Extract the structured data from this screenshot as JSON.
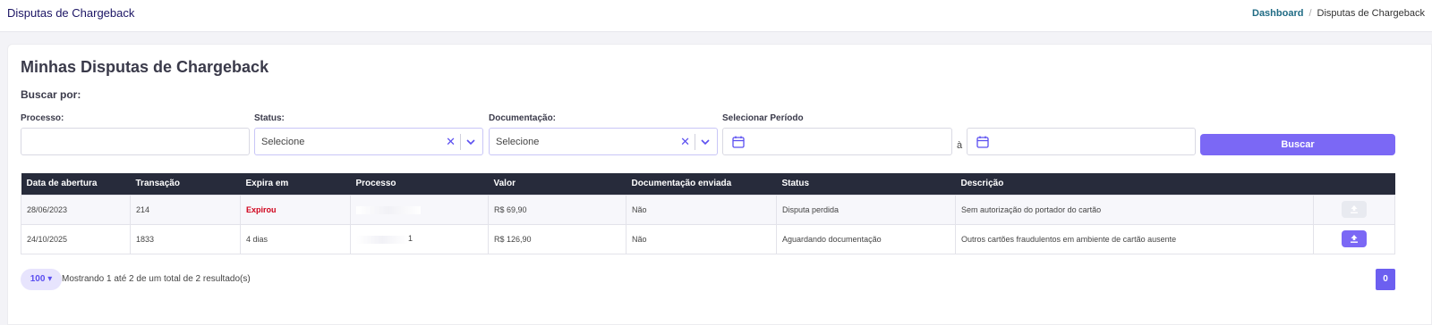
{
  "header": {
    "title": "Disputas de Chargeback",
    "breadcrumb": {
      "link": "Dashboard",
      "separator": "/",
      "current": "Disputas de Chargeback"
    }
  },
  "card": {
    "title": "Minhas Disputas de Chargeback",
    "search_by": "Buscar por:"
  },
  "filters": {
    "processo_label": "Processo:",
    "processo_value": "",
    "status_label": "Status:",
    "status_value": "Selecione",
    "documentacao_label": "Documentação:",
    "documentacao_value": "Selecione",
    "periodo_label": "Selecionar Período",
    "periodo_separator": "à",
    "search_button": "Buscar"
  },
  "table": {
    "headers": [
      "Data de abertura",
      "Transação",
      "Expira em",
      "Processo",
      "Valor",
      "Documentação enviada",
      "Status",
      "Descrição"
    ],
    "rows": [
      {
        "data": "28/06/2023",
        "transacao": "214",
        "expira": "Expirou",
        "processo": "",
        "valor": "R$ 69,90",
        "doc": "Não",
        "status": "Disputa perdida",
        "descricao": "Sem autorização do portador do cartão"
      },
      {
        "data": "24/10/2025",
        "transacao": "1833",
        "expira": "4 dias",
        "processo": "1",
        "valor": "R$ 126,90",
        "doc": "Não",
        "status": "Aguardando documentação",
        "descricao": "Outros cartões fraudulentos em ambiente de cartão ausente"
      }
    ]
  },
  "pagination": {
    "page_size": "100",
    "info": "Mostrando 1 até 2 de um total de 2 resultado(s)",
    "current_page": "0"
  },
  "colors": {
    "accent": "#7b68f5",
    "header_bg": "#272b3b",
    "expired": "#d0021b"
  }
}
